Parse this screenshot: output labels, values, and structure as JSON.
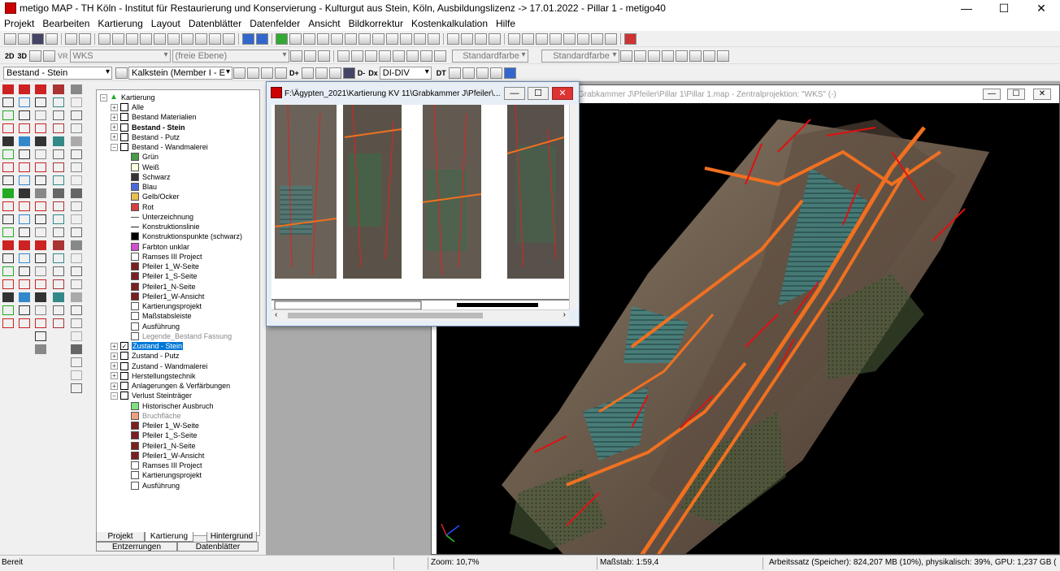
{
  "window": {
    "title": "metigo MAP - TH Köln - Institut für Restaurierung und Konservierung - Kulturgut aus Stein, Köln, Ausbildungslizenz -> 17.01.2022 - Pillar 1 - metigo40",
    "minimize": "—",
    "maximize": "☐",
    "close": "✕"
  },
  "menu": [
    "Projekt",
    "Bearbeiten",
    "Kartierung",
    "Layout",
    "Datenblätter",
    "Datenfelder",
    "Ansicht",
    "Bildkorrektur",
    "Kostenkalkulation",
    "Hilfe"
  ],
  "toolbar2": {
    "btn_2d": "2D",
    "btn_3d": "3D",
    "btn_vr": "VR",
    "coord_combo": "WKS",
    "plane_combo": "(freie Ebene)",
    "color_combo_1": "Standardfarbe",
    "color_combo_2": "Standardfarbe"
  },
  "toolbar3": {
    "layer_combo": "Bestand - Stein",
    "material_combo": "Kalkstein (Member I - E",
    "div_combo": "DI-DIV",
    "d_plus": "D+",
    "d_minus": "D-",
    "dx": "Dx",
    "dt": "DT"
  },
  "tree": {
    "root": "Kartierung",
    "nodes": [
      {
        "label": "Alle",
        "exp": "+",
        "cb": "",
        "bold": false
      },
      {
        "label": "Bestand Materialien",
        "exp": "+",
        "cb": "",
        "bold": false
      },
      {
        "label": "Bestand - Stein",
        "exp": "+",
        "cb": "",
        "bold": true
      },
      {
        "label": "Bestand - Putz",
        "exp": "+",
        "cb": "",
        "bold": false
      },
      {
        "label": "Bestand - Wandmalerei",
        "exp": "−",
        "cb": "",
        "bold": false
      },
      {
        "label": "Grün",
        "swatch": "#4a9a4a"
      },
      {
        "label": "Weiß",
        "swatch": "#fffde0"
      },
      {
        "label": "Schwarz",
        "swatch": "#333333"
      },
      {
        "label": "Blau",
        "swatch": "#4a6ad8"
      },
      {
        "label": "Gelb/Ocker",
        "swatch": "#e8c050"
      },
      {
        "label": "Rot",
        "swatch": "#d84040"
      },
      {
        "label": "Unterzeichnung",
        "line": "#555555"
      },
      {
        "label": "Konstruktionslinie",
        "line": "#222222"
      },
      {
        "label": "Konstruktionspunkte (schwarz)",
        "swatch": "#000000"
      },
      {
        "label": "Farbton unklar",
        "swatch": "#d050d0"
      },
      {
        "label": "Ramses III Project",
        "swatch": "#ffffff"
      },
      {
        "label": "Pfeiler 1_W-Seite",
        "swatch": "#7a2020"
      },
      {
        "label": "Pfeiler 1_S-Seite",
        "swatch": "#7a2020"
      },
      {
        "label": "Pfeiler1_N-Seite",
        "swatch": "#7a2020"
      },
      {
        "label": "Pfeiler1_W-Ansicht",
        "swatch": "#7a2020"
      },
      {
        "label": "Kartierungsprojekt",
        "swatch": "#ffffff"
      },
      {
        "label": "Maßstabsleiste",
        "swatch": "#ffffff"
      },
      {
        "label": "Ausführung",
        "swatch": "#ffffff"
      },
      {
        "label": "Legende_Bestand Fassung",
        "swatch": "#ffffff",
        "gray": true
      },
      {
        "label": "Zustand - Stein",
        "exp": "+",
        "cb": "✓",
        "selected": true
      },
      {
        "label": "Zustand - Putz",
        "exp": "+",
        "cb": ""
      },
      {
        "label": "Zustand - Wandmalerei",
        "exp": "+",
        "cb": ""
      },
      {
        "label": "Herstellungstechnik",
        "exp": "+",
        "cb": ""
      },
      {
        "label": "Anlagerungen & Verfärbungen",
        "exp": "+",
        "cb": ""
      },
      {
        "label": "Verlust Steinträger",
        "exp": "−",
        "cb": ""
      },
      {
        "label": "Historischer Ausbruch",
        "swatch": "#80e080"
      },
      {
        "label": "Bruchfläche",
        "swatch": "#f0a080",
        "gray": true
      },
      {
        "label": "Pfeiler 1_W-Seite",
        "swatch": "#7a2020"
      },
      {
        "label": "Pfeiler 1_S-Seite",
        "swatch": "#7a2020"
      },
      {
        "label": "Pfeiler1_N-Seite",
        "swatch": "#7a2020"
      },
      {
        "label": "Pfeiler1_W-Ansicht",
        "swatch": "#7a2020"
      },
      {
        "label": "Ramses III Project",
        "swatch": "#ffffff"
      },
      {
        "label": "Kartierungsprojekt",
        "swatch": "#ffffff"
      },
      {
        "label": "Ausführung",
        "swatch": "#ffffff"
      }
    ],
    "tabs": [
      "Projekt",
      "Kartierung",
      "Hintergrund"
    ],
    "bottom_buttons": [
      "Entzerrungen",
      "Datenblätter"
    ]
  },
  "main_window": {
    "title": "Grabkammer J\\Pfeiler\\Pillar 1\\Pillar 1.map - Zentralprojektion: \"WKS\" (-)"
  },
  "popup_window": {
    "title": "F:\\Ägypten_2021\\Kartierung KV 11\\Grabkammer J\\Pfeiler\\..."
  },
  "status": {
    "ready": "Bereit",
    "zoom": "Zoom: 10,7%",
    "scale": "Maßstab: 1:59,4",
    "memory": "Arbeitssatz (Speicher): 824,207 MB (10%), physikalisch: 39%, GPU: 1,237 GB ("
  },
  "colors": {
    "selection": "#0078d7",
    "annotation_orange": "#f07020",
    "annotation_red": "#e01010",
    "hatch_teal": "#3a8a8a"
  }
}
